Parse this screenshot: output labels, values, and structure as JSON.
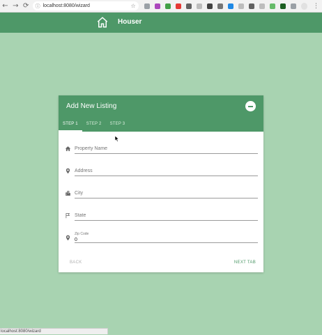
{
  "browser": {
    "url": "localhost:8080/wizard",
    "back_icon": "arrow-left-icon",
    "forward_icon": "arrow-right-icon",
    "reload_icon": "reload-icon",
    "extensions": [
      "#9aa0a6",
      "#ab47bc",
      "#43a047",
      "#e53935",
      "#616161",
      "#bdbdbd",
      "#424242",
      "#757575",
      "#1e88e5",
      "#bdbdbd",
      "#616161",
      "#bdbdbd",
      "#66bb6a",
      "#1b5e20",
      "#9aa0a6"
    ]
  },
  "header": {
    "title": "Houser",
    "logo_icon": "home-icon",
    "color": "#4e9868"
  },
  "card": {
    "title": "Add New Listing",
    "collapse_icon": "minus-circle-icon",
    "tabs": [
      {
        "label": "STEP 1",
        "active": true
      },
      {
        "label": "STEP 2",
        "active": false
      },
      {
        "label": "STEP 3",
        "active": false
      }
    ],
    "fields": {
      "property_name": {
        "placeholder": "Property Name",
        "icon": "home-icon"
      },
      "address": {
        "placeholder": "Address",
        "icon": "map-pin-icon"
      },
      "city": {
        "placeholder": "City",
        "icon": "city-icon"
      },
      "state": {
        "placeholder": "State",
        "icon": "flag-icon"
      },
      "zip": {
        "label": "Zip Code",
        "value": "0",
        "icon": "map-pin-icon"
      }
    },
    "back_label": "BACK",
    "next_label": "NEXT TAB"
  },
  "status": {
    "text": "localhost:8080/wizard"
  },
  "colors": {
    "background": "#a8d3b1",
    "accent": "#4e9868"
  }
}
